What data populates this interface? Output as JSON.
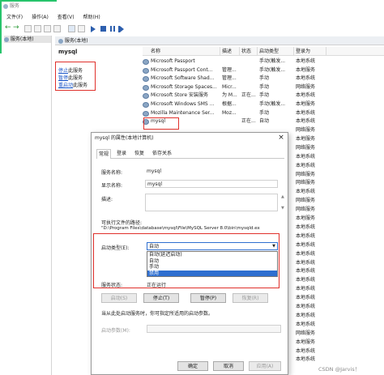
{
  "window": {
    "title": "服务"
  },
  "menu": {
    "file": "文件(F)",
    "action": "操作(A)",
    "view": "查看(V)",
    "help": "帮助(H)"
  },
  "tree": {
    "root_label": "服务(本地)"
  },
  "header": {
    "title": "服务(本地)"
  },
  "details": {
    "service_name": "mysql",
    "stop_prefix": "停止",
    "stop_suffix": "此服务",
    "pause_prefix": "暂停",
    "pause_suffix": "此服务",
    "restart_prefix": "重启动",
    "restart_suffix": "此服务"
  },
  "columns": {
    "name": "名称",
    "desc": "描述",
    "status": "状态",
    "startup": "启动类型",
    "logon": "登录为"
  },
  "services": [
    {
      "name": "Microsoft Passport",
      "desc": "",
      "status": "",
      "startup": "手动(触发...",
      "logon": "本地系统"
    },
    {
      "name": "Microsoft Passport Cont...",
      "desc": "管理...",
      "status": "",
      "startup": "手动(触发...",
      "logon": "本地服务"
    },
    {
      "name": "Microsoft Software Shad...",
      "desc": "管理...",
      "status": "",
      "startup": "手动",
      "logon": "本地系统"
    },
    {
      "name": "Microsoft Storage Spaces...",
      "desc": "Micr...",
      "status": "",
      "startup": "手动",
      "logon": "网络服务"
    },
    {
      "name": "Microsoft Store 安装服务",
      "desc": "为 M...",
      "status": "正在...",
      "startup": "手动",
      "logon": "本地系统"
    },
    {
      "name": "Microsoft Windows SMS ...",
      "desc": "根据...",
      "status": "",
      "startup": "手动(触发...",
      "logon": "本地服务"
    },
    {
      "name": "Mozilla Maintenance Ser...",
      "desc": "Moz...",
      "status": "",
      "startup": "手动",
      "logon": "本地系统"
    },
    {
      "name": "mysql",
      "desc": "",
      "status": "正在...",
      "startup": "自动",
      "logon": "本地系统"
    }
  ],
  "right_logon_column": [
    "网络服务",
    "本地服务",
    "网络服务",
    "本地系统",
    "本地系统",
    "网络服务",
    "网络服务",
    "本地系统",
    "网络服务",
    "网络服务",
    "本地服务",
    "本地系统",
    "本地系统",
    "本地系统",
    "本地系统",
    "本地系统",
    "本地系统",
    "本地系统",
    "本地系统",
    "本地系统",
    "本地系统",
    "本地系统",
    "本地系统",
    "网络服务",
    "本地服务",
    "本地系统",
    "本地系统"
  ],
  "dialog": {
    "title": "mysql 的属性(本地计算机)",
    "close_glyph": "×",
    "tabs": [
      "常规",
      "登录",
      "恢复",
      "依存关系"
    ],
    "service_name_label": "服务名称:",
    "service_name_value": "mysql",
    "display_name_label": "显示名称:",
    "display_name_value": "mysql",
    "description_label": "描述:",
    "exe_path_label": "可执行文件的路径:",
    "exe_path_value": "\"D:\\Program Files\\database\\mysql\\File\\MySQL Server 8.0\\bin\\mysqld.ex",
    "startup_type_label": "启动类型(E):",
    "startup_type_selected": "自动",
    "startup_options": [
      "自动(延迟启动)",
      "自动",
      "手动",
      "禁用"
    ],
    "highlighted_option_index": 3,
    "service_status_label": "服务状态:",
    "service_status_value": "正在运行",
    "buttons": {
      "start": "启动(S)",
      "stop": "停止(T)",
      "pause": "暂停(P)",
      "resume": "恢复(R)"
    },
    "hint": "当从此处启动服务时，你可指定所适用的启动参数。",
    "start_params_label": "启动参数(M):",
    "ok": "确定",
    "cancel": "取消",
    "apply": "应用(A)"
  },
  "watermark": "CSDN @Jarvis！",
  "colors": {
    "accent_green": "#27c46b",
    "highlight_red": "#e0312c",
    "selection_blue": "#2f6fd0",
    "link_blue": "#1a55c8"
  }
}
